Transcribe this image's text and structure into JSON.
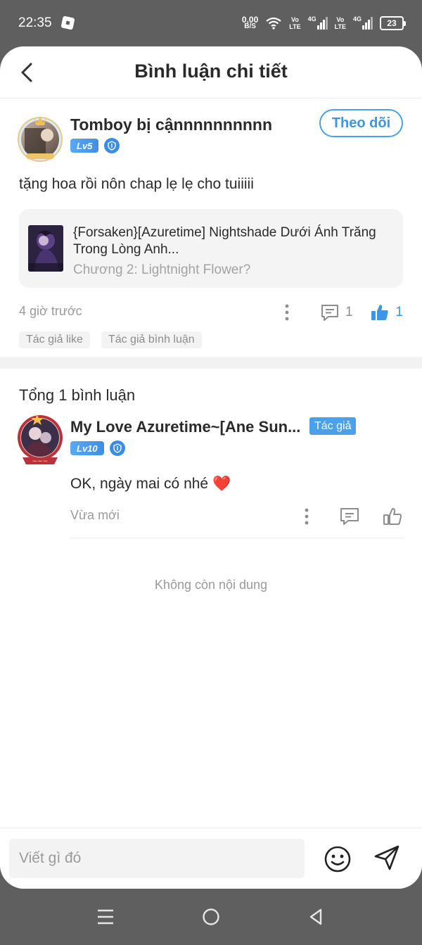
{
  "status_bar": {
    "time": "22:35",
    "net_speed_value": "0,00",
    "net_speed_unit": "B/S",
    "sim1_label_top": "Vo",
    "sim1_label_bottom": "LTE",
    "sim1_network": "4G",
    "sim2_label_top": "Vo",
    "sim2_label_bottom": "LTE",
    "sim2_network": "4G",
    "battery": "23"
  },
  "header": {
    "title": "Bình luận chi tiết"
  },
  "post": {
    "username": "Tomboy bị cậnnnnnnnnnn",
    "level": "Lv5",
    "follow_label": "Theo dõi",
    "text": "tặng hoa rồi nôn chap lẹ lẹ cho tuiiiii",
    "story": {
      "title": "{Forsaken}[Azuretime] Nightshade Dưới Ánh Trăng Trong Lòng Anh...",
      "chapter": "Chương 2: Lightnight Flower?"
    },
    "time_ago": "4 giờ trước",
    "reply_count": "1",
    "like_count": "1",
    "tags": [
      "Tác giả like",
      "Tác giả bình luận"
    ]
  },
  "replies_section": {
    "total_label": "Tổng 1 bình luận",
    "end_label": "Không còn nội dung"
  },
  "reply": {
    "username": "My Love Azuretime~[Ane Sun...",
    "author_badge": "Tác giả",
    "level": "Lv10",
    "text": "OK, ngày mai có nhé",
    "emoji": "❤️",
    "time": "Vừa mới"
  },
  "composer": {
    "placeholder": "Viết gì đó"
  },
  "colors": {
    "accent": "#3c96e4",
    "status_bar": "#5f5f5f",
    "divider": "#f2f2f2"
  },
  "icons": [
    "back-arrow-icon",
    "shield-icon",
    "more-dots-icon",
    "comment-icon",
    "thumbs-up-icon",
    "emoji-icon",
    "send-icon",
    "menu-icon",
    "home-circle-icon",
    "back-triangle-icon"
  ]
}
